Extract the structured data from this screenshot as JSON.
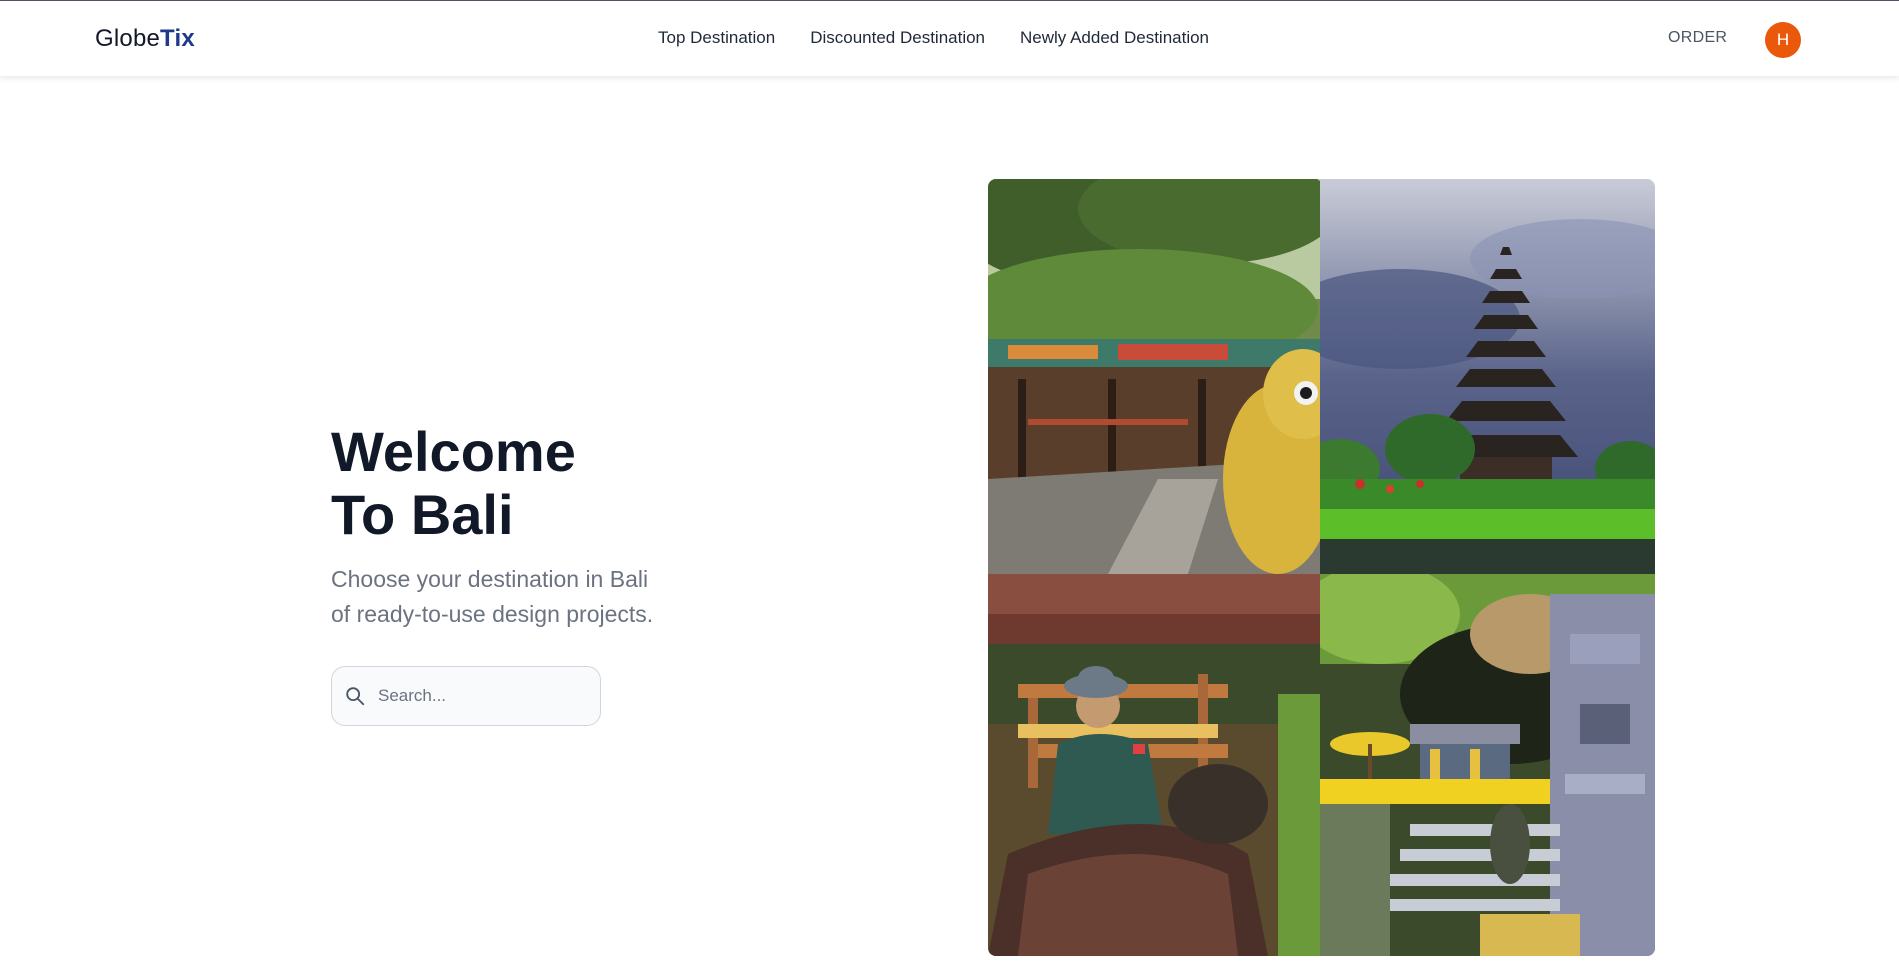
{
  "header": {
    "logo_prefix": "Globe",
    "logo_suffix": "Tix",
    "nav": [
      {
        "label": "Top Destination"
      },
      {
        "label": "Discounted Destination"
      },
      {
        "label": "Newly Added Destination"
      }
    ],
    "order_label": "ORDER",
    "avatar_initial": "H"
  },
  "hero": {
    "title_line1": "Welcome",
    "title_line2": "To Bali",
    "subtitle_line1": "Choose your destination in Bali",
    "subtitle_line2": "of ready-to-use design projects.",
    "search_placeholder": "Search..."
  },
  "colors": {
    "brand_accent": "#1e3a8a",
    "avatar_bg": "#ea580c"
  }
}
